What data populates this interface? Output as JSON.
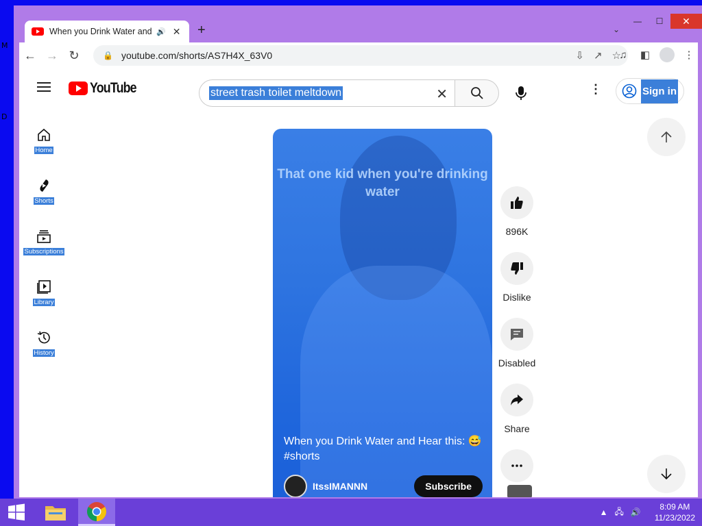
{
  "desktop": {
    "chars": [
      "M",
      "D"
    ]
  },
  "browser": {
    "tab_title": "When you Drink Water and H",
    "url": "youtube.com/shorts/AS7H4X_63V0",
    "new_tab_symbol": "+",
    "win_min": "—",
    "win_max": "☐",
    "win_close": "✕"
  },
  "youtube": {
    "logo_text": "YouTube",
    "search_query": "street trash toilet meltdown",
    "sign_in": "Sign in",
    "sidebar": [
      {
        "label": "Home",
        "icon": "home-icon"
      },
      {
        "label": "Shorts",
        "icon": "shorts-icon"
      },
      {
        "label": "Subscriptions",
        "icon": "subscriptions-icon"
      },
      {
        "label": "Library",
        "icon": "library-icon"
      },
      {
        "label": "History",
        "icon": "history-icon"
      }
    ],
    "short": {
      "caption": "That one kid when you're drinking water",
      "title": "When you Drink Water and Hear this: 😅 #shorts",
      "channel": "ItssIMANNN",
      "subscribe": "Subscribe"
    },
    "actions": {
      "likes": "896K",
      "dislike": "Dislike",
      "comments": "Disabled",
      "share": "Share"
    }
  },
  "taskbar": {
    "time": "8:09 AM",
    "date": "11/23/2022"
  },
  "colors": {
    "brand_red": "#ff0000",
    "selection_blue": "#3b7fd9",
    "window_frame": "#b07be8",
    "taskbar": "#6a3fd8"
  }
}
